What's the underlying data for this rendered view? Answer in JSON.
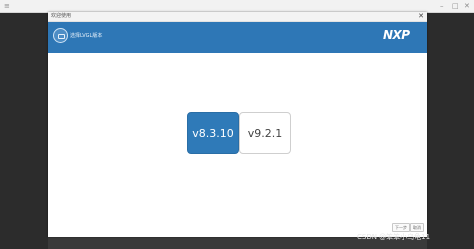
{
  "window": {
    "title": "欢迎使用",
    "close_symbol": "✕"
  },
  "banner": {
    "title": "选择LVGL版本",
    "logo": "NXP",
    "icon": "chip-icon"
  },
  "versions": [
    {
      "label": "v8.3.10",
      "selected": true
    },
    {
      "label": "v9.2.1",
      "selected": false
    }
  ],
  "footer": {
    "next_label": "下一步",
    "cancel_label": "取消"
  },
  "watermark": "CSDN @笨笨小乌龟11",
  "colors": {
    "accent": "#2e77b6",
    "selected_button": "#2f7ab8",
    "backdrop": "#3a3a3a"
  }
}
